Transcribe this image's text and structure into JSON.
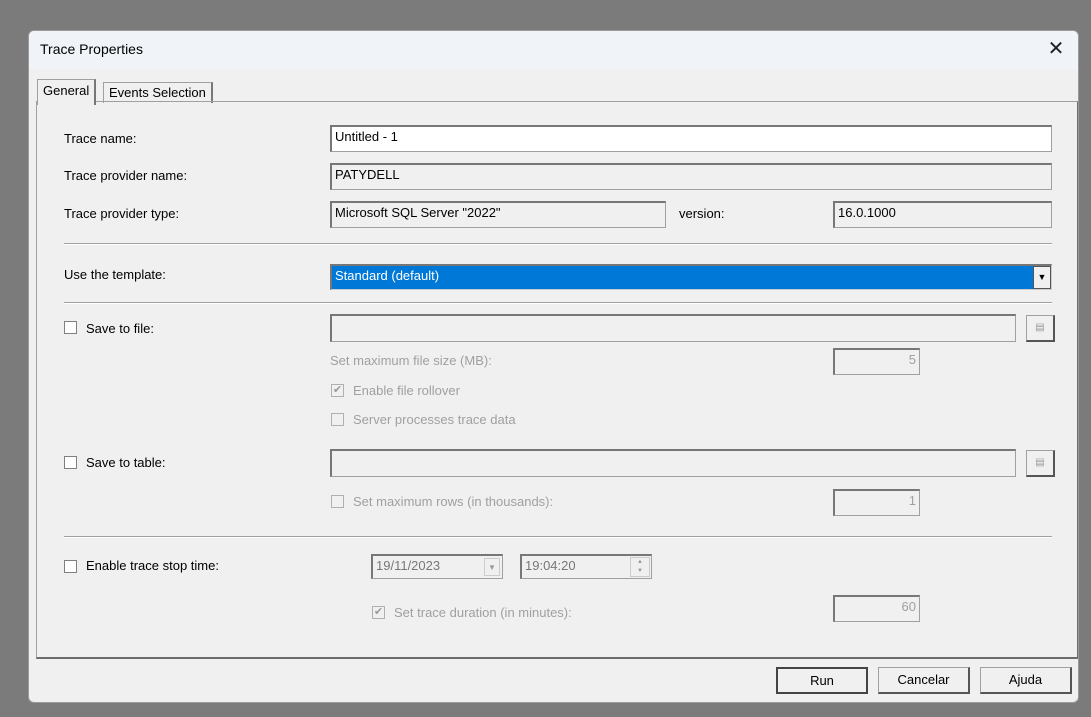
{
  "window": {
    "title": "Trace Properties",
    "close_icon": "close-icon"
  },
  "tabs": [
    {
      "label": "General",
      "active": true
    },
    {
      "label": "Events Selection",
      "active": false
    }
  ],
  "form": {
    "trace_name": {
      "label": "Trace name:",
      "value": "Untitled - 1"
    },
    "provider_name": {
      "label": "Trace provider name:",
      "value": "PATYDELL"
    },
    "provider_type": {
      "label": "Trace provider type:",
      "value": "Microsoft SQL Server \"2022\""
    },
    "version": {
      "label": "version:",
      "value": "16.0.1000"
    },
    "template": {
      "label": "Use the template:",
      "value": "Standard (default)"
    },
    "save_to_file": {
      "label": "Save to file:",
      "checked": false,
      "value": ""
    },
    "max_file_size": {
      "label": "Set maximum file size (MB):",
      "value": "5"
    },
    "file_rollover": {
      "label": "Enable file rollover",
      "checked": true
    },
    "server_processes": {
      "label": "Server processes trace data",
      "checked": false
    },
    "save_to_table": {
      "label": "Save to table:",
      "checked": false,
      "value": ""
    },
    "max_rows": {
      "label": "Set maximum rows (in thousands):",
      "checked": false,
      "value": "1"
    },
    "stop_time": {
      "label": "Enable trace stop time:",
      "checked": false,
      "date": "19/11/2023",
      "time": "19:04:20"
    },
    "duration": {
      "label": "Set trace duration (in minutes):",
      "checked": true,
      "value": "60"
    }
  },
  "buttons": {
    "run": "Run",
    "cancel": "Cancelar",
    "help": "Ajuda"
  },
  "colors": {
    "selection": "#0078d7"
  }
}
